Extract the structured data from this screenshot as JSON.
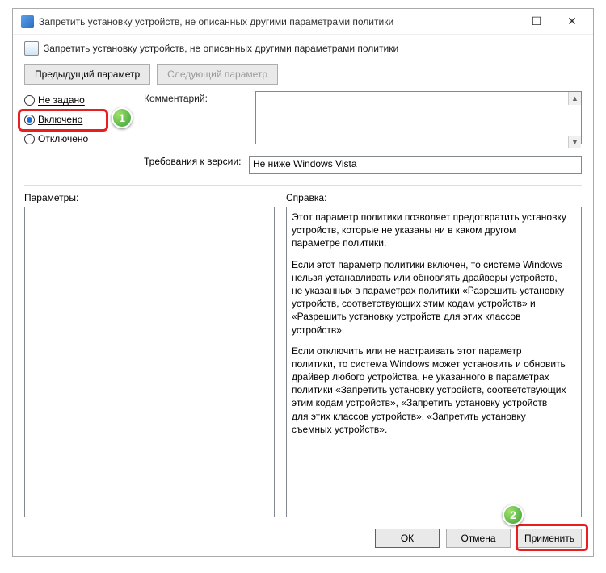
{
  "window": {
    "title": "Запретить установку устройств, не описанных другими параметрами политики"
  },
  "header": {
    "title": "Запретить установку устройств, не описанных другими параметрами политики"
  },
  "nav": {
    "prev": "Предыдущий параметр",
    "next": "Следующий параметр"
  },
  "radios": {
    "not_configured": "Не задано",
    "enabled": "Включено",
    "disabled": "Отключено"
  },
  "labels": {
    "comment": "Комментарий:",
    "requirements": "Требования к версии:",
    "parameters": "Параметры:",
    "help": "Справка:"
  },
  "fields": {
    "comment_value": "",
    "requirements_value": "Не ниже Windows Vista"
  },
  "help_text": {
    "p1": "Этот параметр политики позволяет предотвратить установку устройств, которые не указаны ни в каком другом параметре политики.",
    "p2": "Если этот параметр политики включен, то системе Windows нельзя устанавливать или обновлять драйверы устройств, не указанных в параметрах политики «Разрешить установку устройств, соответствующих этим кодам устройств» и «Разрешить установку устройств для этих классов устройств».",
    "p3": "Если отключить или не настраивать этот параметр политики, то система Windows может установить и обновить драйвер любого устройства, не указанного в параметрах политики «Запретить установку устройств, соответствующих этим кодам устройств», «Запретить установку устройств для этих классов устройств», «Запретить установку съемных устройств»."
  },
  "buttons": {
    "ok": "ОК",
    "cancel": "Отмена",
    "apply": "Применить"
  },
  "annotations": {
    "badge1": "1",
    "badge2": "2"
  }
}
